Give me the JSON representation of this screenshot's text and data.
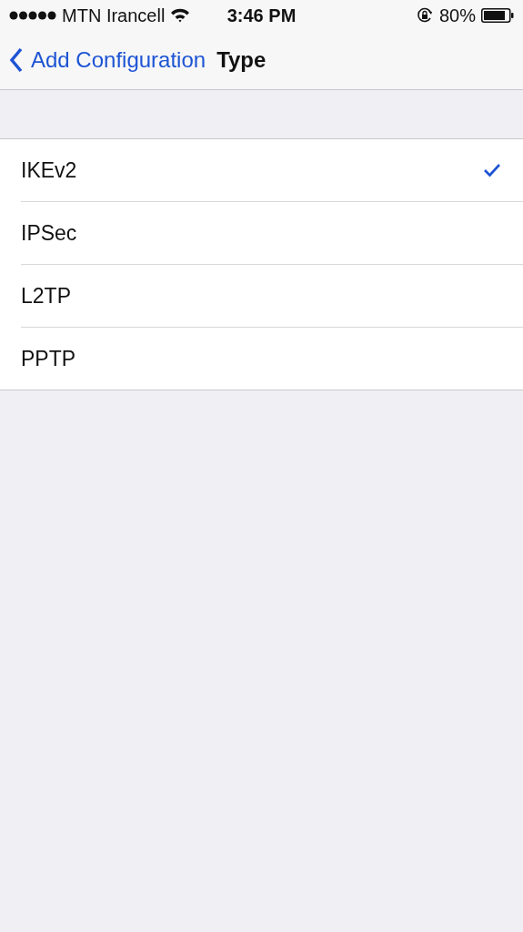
{
  "status_bar": {
    "carrier": "MTN Irancell",
    "time": "3:46 PM",
    "battery": "80%"
  },
  "nav_bar": {
    "back": "Add Configuration",
    "title": "Type"
  },
  "options": [
    {
      "label": "IKEv2",
      "selected": true
    },
    {
      "label": "IPSec",
      "selected": false
    },
    {
      "label": "L2TP",
      "selected": false
    },
    {
      "label": "PPTP",
      "selected": false
    }
  ]
}
